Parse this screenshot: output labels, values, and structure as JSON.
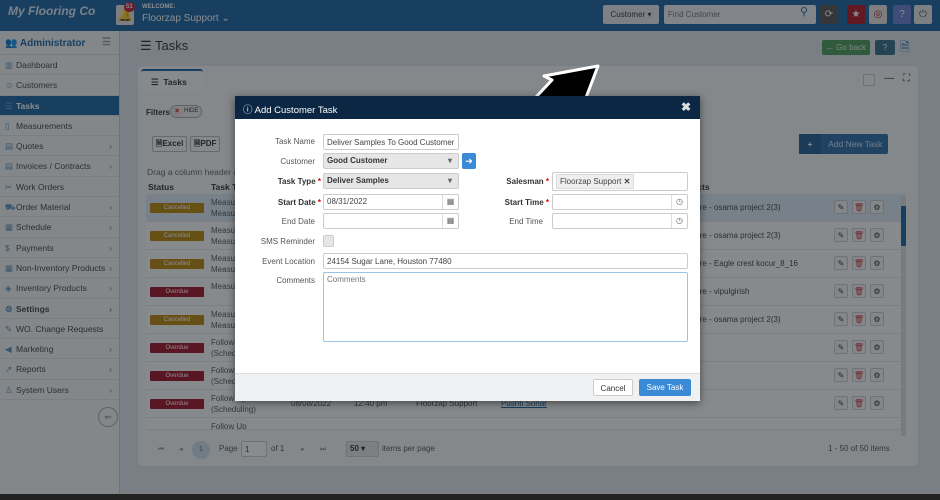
{
  "header": {
    "brand": "My Flooring Co",
    "notifications": "51",
    "welcome": "WELCOME:",
    "user": "Floorzap Support",
    "search_scope": "Customer",
    "search_placeholder": "Find Customer"
  },
  "sidebar": {
    "role": "Administrator",
    "items": [
      {
        "label": "Dashboard",
        "icon": "chart-icon",
        "chev": false
      },
      {
        "label": "Customers",
        "icon": "users-icon",
        "chev": false
      },
      {
        "label": "Tasks",
        "icon": "tasks-icon",
        "chev": false,
        "active": true
      },
      {
        "label": "Measurements",
        "icon": "ruler-icon",
        "chev": false
      },
      {
        "label": "Quotes",
        "icon": "quote-icon",
        "chev": true
      },
      {
        "label": "Invoices / Contracts",
        "icon": "invoice-icon",
        "chev": true
      },
      {
        "label": "Work Orders",
        "icon": "tools-icon",
        "chev": false
      },
      {
        "label": "Order Material",
        "icon": "cart-icon",
        "chev": true
      },
      {
        "label": "Schedule",
        "icon": "calendar-icon",
        "chev": true
      },
      {
        "label": "Payments",
        "icon": "dollar-icon",
        "chev": true
      },
      {
        "label": "Non-Inventory Products",
        "icon": "grid-icon",
        "chev": true
      },
      {
        "label": "Inventory Products",
        "icon": "boxes-icon",
        "chev": true
      },
      {
        "label": "Settings",
        "icon": "gear-icon",
        "chev": true
      },
      {
        "label": "WO. Change Requests",
        "icon": "edit-icon",
        "chev": false
      },
      {
        "label": "Marketing",
        "icon": "megaphone-icon",
        "chev": true
      },
      {
        "label": "Reports",
        "icon": "line-chart-icon",
        "chev": true
      },
      {
        "label": "System Users",
        "icon": "user-icon",
        "chev": true
      }
    ]
  },
  "page": {
    "title": "Tasks",
    "go_back": "Go back",
    "tab": "Tasks",
    "filters": "Filters",
    "hide": "HIDE",
    "excel": "Excel",
    "pdf": "PDF",
    "drag_hint": "Drag a column header and",
    "add_task": "Add New Task"
  },
  "table": {
    "columns": {
      "status": "Status",
      "task_type": "Task Type",
      "project": "Projects"
    },
    "rows": [
      {
        "status": "Cancelled",
        "task": "Measurement Measurement",
        "project": "Square - osama project 2(3)"
      },
      {
        "status": "Cancelled",
        "task": "Measurement Measurement",
        "project": "Square - osama project 2(3)"
      },
      {
        "status": "Cancelled",
        "task": "Measurement Measurement",
        "project": "Square - Eagle crest kocur_8_16"
      },
      {
        "status": "Overdue",
        "task": "Measurement",
        "project": "Square - vipulgirish"
      },
      {
        "status": "Cancelled",
        "task": "Measurement Measurement",
        "project": "Square - osama project 2(3)"
      },
      {
        "status": "Overdue",
        "task": "Follow Up (Scheduling)",
        "project": ""
      },
      {
        "status": "Overdue",
        "task": "Follow Up (Scheduling)",
        "project": ""
      },
      {
        "status": "Overdue",
        "task": "Follow Up (Scheduling)",
        "date": "08/08/2022",
        "time": "12:40 pm",
        "salesman": "Floorzap Support",
        "customer": "Pushti Sonar",
        "project": ""
      },
      {
        "status": "",
        "task": "Follow Up",
        "project": ""
      }
    ]
  },
  "pager": {
    "page_label": "Page",
    "page": "1",
    "of": "of 1",
    "per_page": "50",
    "per_page_label": "items per page",
    "summary": "1 - 50 of 50 items"
  },
  "modal": {
    "title": "Add Customer Task",
    "task_name_label": "Task Name",
    "task_name": "Deliver Samples To Good Customer",
    "customer_label": "Customer",
    "customer": "Good Customer",
    "task_type_label": "Task Type",
    "task_type": "Deliver Samples",
    "salesman_label": "Salesman",
    "salesman": "Floorzap Support",
    "start_date_label": "Start Date",
    "start_date": "08/31/2022",
    "start_time_label": "Start Time",
    "start_time": "",
    "end_date_label": "End Date",
    "end_date": "",
    "end_time_label": "End Time",
    "end_time": "",
    "sms_label": "SMS Reminder",
    "sms_checked": false,
    "location_label": "Event Location",
    "location": "24154 Sugar Lane, Houston 77480",
    "comments_label": "Comments",
    "comments_placeholder": "Comments",
    "cancel": "Cancel",
    "save": "Save Task"
  },
  "colors": {
    "brand": "#1d64a3",
    "cancelled": "#b8860b",
    "overdue": "#a3122a",
    "modal_header": "#0b2744",
    "save": "#3a8ad6"
  }
}
